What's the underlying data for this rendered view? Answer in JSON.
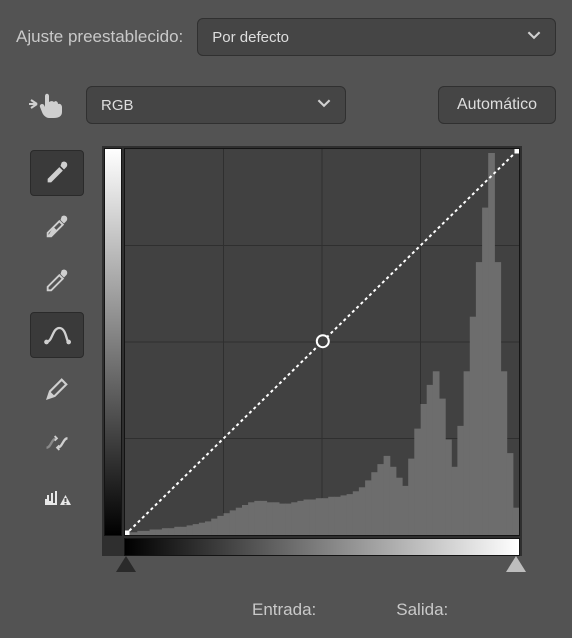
{
  "preset": {
    "label": "Ajuste preestablecido:",
    "value": "Por defecto"
  },
  "channel": {
    "value": "RGB"
  },
  "auto_button": "Automático",
  "io": {
    "input_label": "Entrada:",
    "output_label": "Salida:"
  },
  "chart_data": {
    "type": "line",
    "title": "Curves",
    "xlabel": "Input",
    "ylabel": "Output",
    "xlim": [
      0,
      255
    ],
    "ylim": [
      0,
      255
    ],
    "series": [
      {
        "name": "RGB curve",
        "x": [
          0,
          128,
          255
        ],
        "y": [
          0,
          128,
          255
        ]
      }
    ],
    "histogram": {
      "bins": 64,
      "values": [
        2,
        2,
        3,
        3,
        4,
        4,
        5,
        5,
        6,
        6,
        7,
        8,
        9,
        10,
        12,
        14,
        16,
        18,
        20,
        22,
        24,
        25,
        25,
        24,
        24,
        23,
        23,
        24,
        25,
        26,
        26,
        27,
        27,
        28,
        28,
        29,
        30,
        32,
        35,
        40,
        46,
        52,
        58,
        50,
        42,
        36,
        56,
        78,
        96,
        110,
        120,
        100,
        70,
        50,
        80,
        120,
        160,
        200,
        240,
        280,
        200,
        120,
        60,
        20
      ]
    }
  }
}
